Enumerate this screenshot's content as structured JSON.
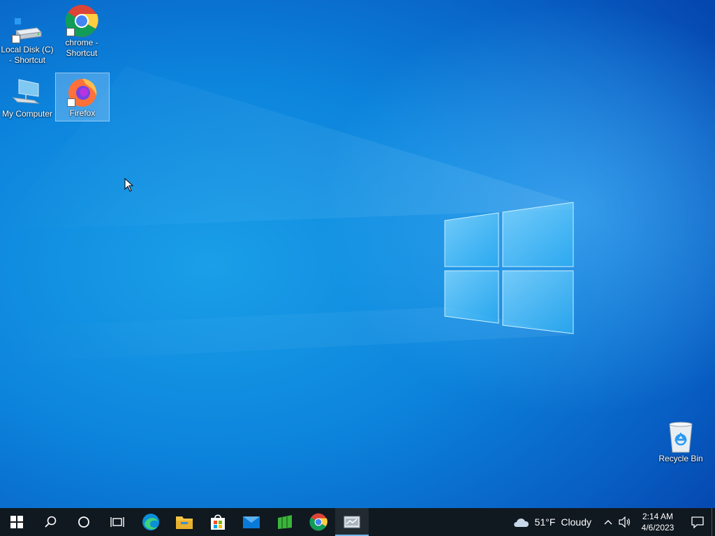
{
  "desktop": {
    "icons": [
      {
        "label": "Local Disk (C) - Shortcut",
        "icon": "drive-icon"
      },
      {
        "label": "chrome - Shortcut",
        "icon": "chrome-icon"
      },
      {
        "label": "My Computer",
        "icon": "computer-icon"
      },
      {
        "label": "Firefox",
        "icon": "firefox-icon",
        "selected": true
      },
      {
        "label": "Recycle Bin",
        "icon": "recycle-bin-icon"
      }
    ]
  },
  "taskbar": {
    "apps": [
      {
        "name": "start",
        "icon": "windows-start-icon"
      },
      {
        "name": "search",
        "icon": "search-icon"
      },
      {
        "name": "cortana",
        "icon": "cortana-icon"
      },
      {
        "name": "task-view",
        "icon": "task-view-icon"
      },
      {
        "name": "edge",
        "icon": "edge-icon"
      },
      {
        "name": "file-explorer",
        "icon": "folder-icon"
      },
      {
        "name": "store",
        "icon": "store-icon"
      },
      {
        "name": "mail",
        "icon": "mail-icon"
      },
      {
        "name": "minesweeper",
        "icon": "green-app-icon"
      },
      {
        "name": "chrome",
        "icon": "chrome-icon"
      },
      {
        "name": "app",
        "icon": "app-icon",
        "active": true
      }
    ],
    "weather": {
      "temp": "51°F",
      "condition": "Cloudy"
    },
    "clock": {
      "time": "2:14 AM",
      "date": "4/6/2023"
    }
  },
  "colors": {
    "taskbar": "#101820",
    "desktop_blue": "#0c84dc",
    "accent": "#76b9ed"
  }
}
